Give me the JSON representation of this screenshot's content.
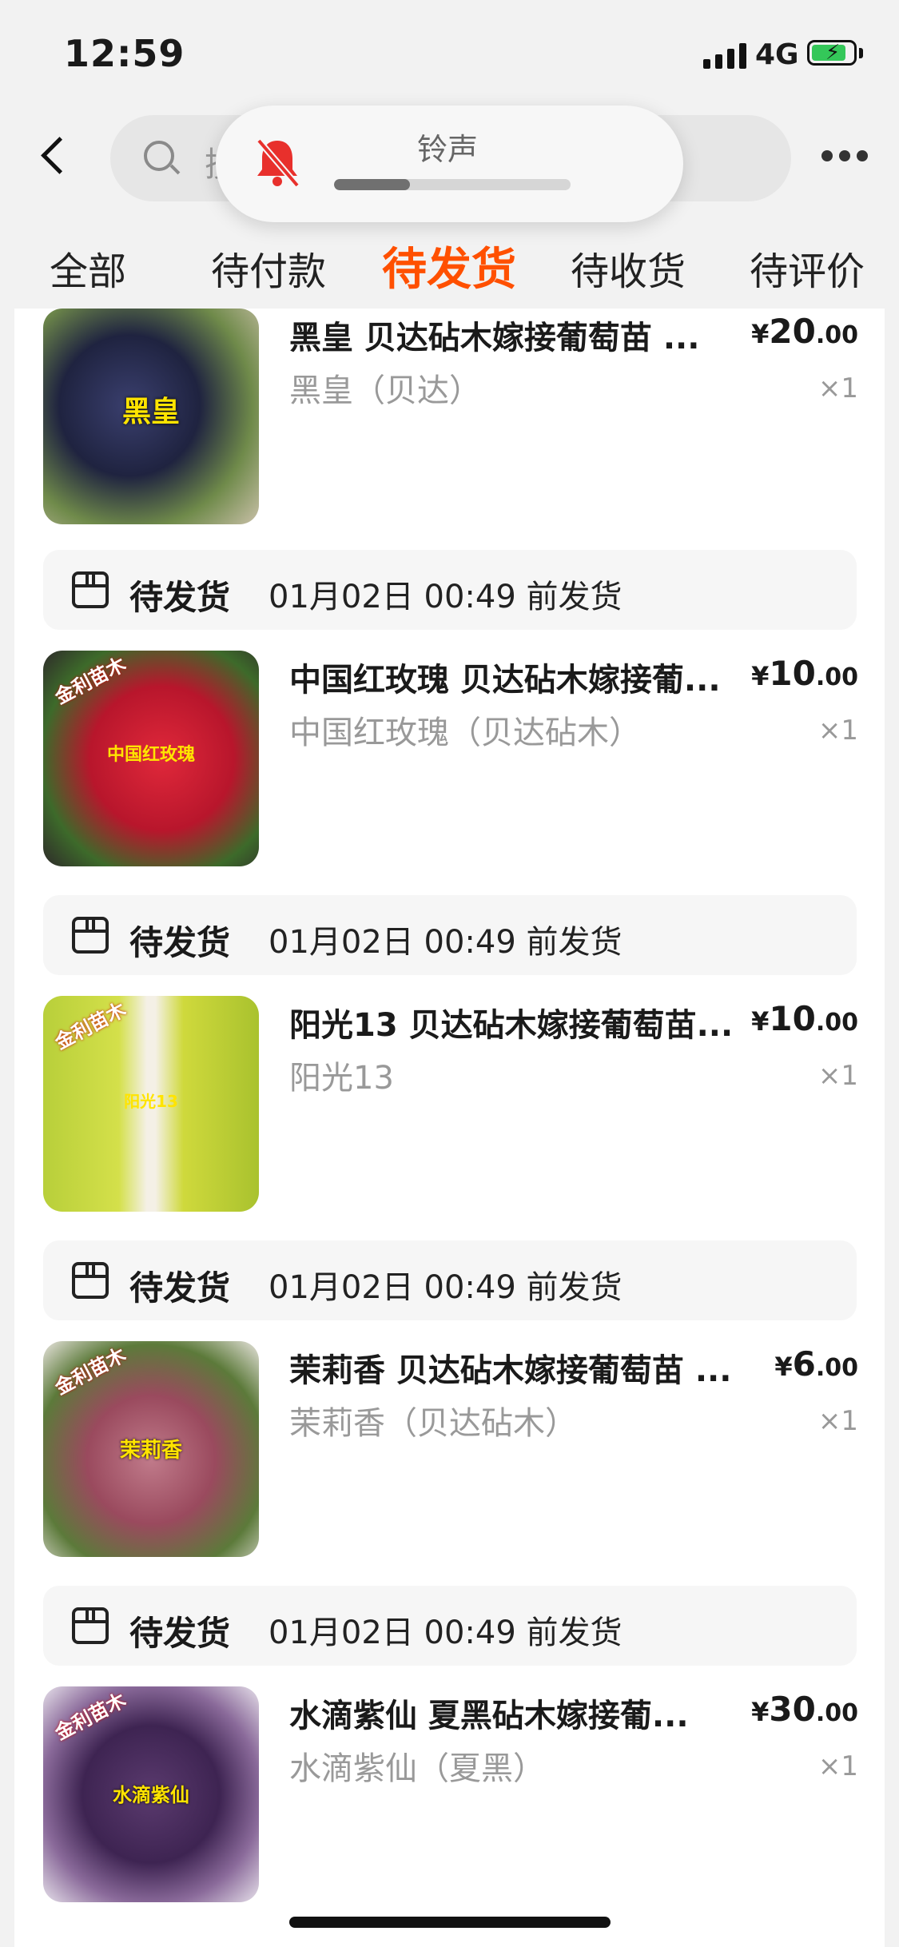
{
  "status_bar": {
    "time": "12:59",
    "network": "4G"
  },
  "nav": {
    "search_placeholder": "搜"
  },
  "ringer_hud": {
    "label": "铃声",
    "icon": "bell-muted-icon",
    "volume_level": 0.32
  },
  "tabs": [
    {
      "label": "全部",
      "active": false
    },
    {
      "label": "待付款",
      "active": false
    },
    {
      "label": "待发货",
      "active": true
    },
    {
      "label": "待收货",
      "active": false
    },
    {
      "label": "待评价",
      "active": false
    }
  ],
  "orders": [
    {
      "thumb_text": "黑皇",
      "title": "黑皇 贝达砧木嫁接葡萄苗 ...",
      "sku": "黑皇（贝达）",
      "currency": "¥",
      "price_int": "20",
      "price_dec": ".00",
      "qty": "×1"
    },
    {
      "status": "待发货",
      "ship_time": "01月02日 00:49 前发货",
      "thumb_text": "中国红玫瑰",
      "title": "中国红玫瑰 贝达砧木嫁接葡...",
      "sku": "中国红玫瑰（贝达砧木）",
      "currency": "¥",
      "price_int": "10",
      "price_dec": ".00",
      "qty": "×1"
    },
    {
      "status": "待发货",
      "ship_time": "01月02日 00:49 前发货",
      "thumb_text": "阳光13",
      "title": "阳光13 贝达砧木嫁接葡萄苗...",
      "sku": "阳光13",
      "currency": "¥",
      "price_int": "10",
      "price_dec": ".00",
      "qty": "×1"
    },
    {
      "status": "待发货",
      "ship_time": "01月02日 00:49 前发货",
      "thumb_text": "茉莉香",
      "title": "茉莉香 贝达砧木嫁接葡萄苗 ...",
      "sku": "茉莉香（贝达砧木）",
      "currency": "¥",
      "price_int": "6",
      "price_dec": ".00",
      "qty": "×1"
    },
    {
      "status": "待发货",
      "ship_time": "01月02日 00:49 前发货",
      "thumb_text": "水滴紫仙",
      "title": "水滴紫仙 夏黑砧木嫁接葡...",
      "sku": "水滴紫仙（夏黑）",
      "currency": "¥",
      "price_int": "30",
      "price_dec": ".00",
      "qty": "×1"
    }
  ],
  "colors": {
    "accent": "#ff5000",
    "battery": "#34c759",
    "muted_bell": "#e8302c"
  }
}
